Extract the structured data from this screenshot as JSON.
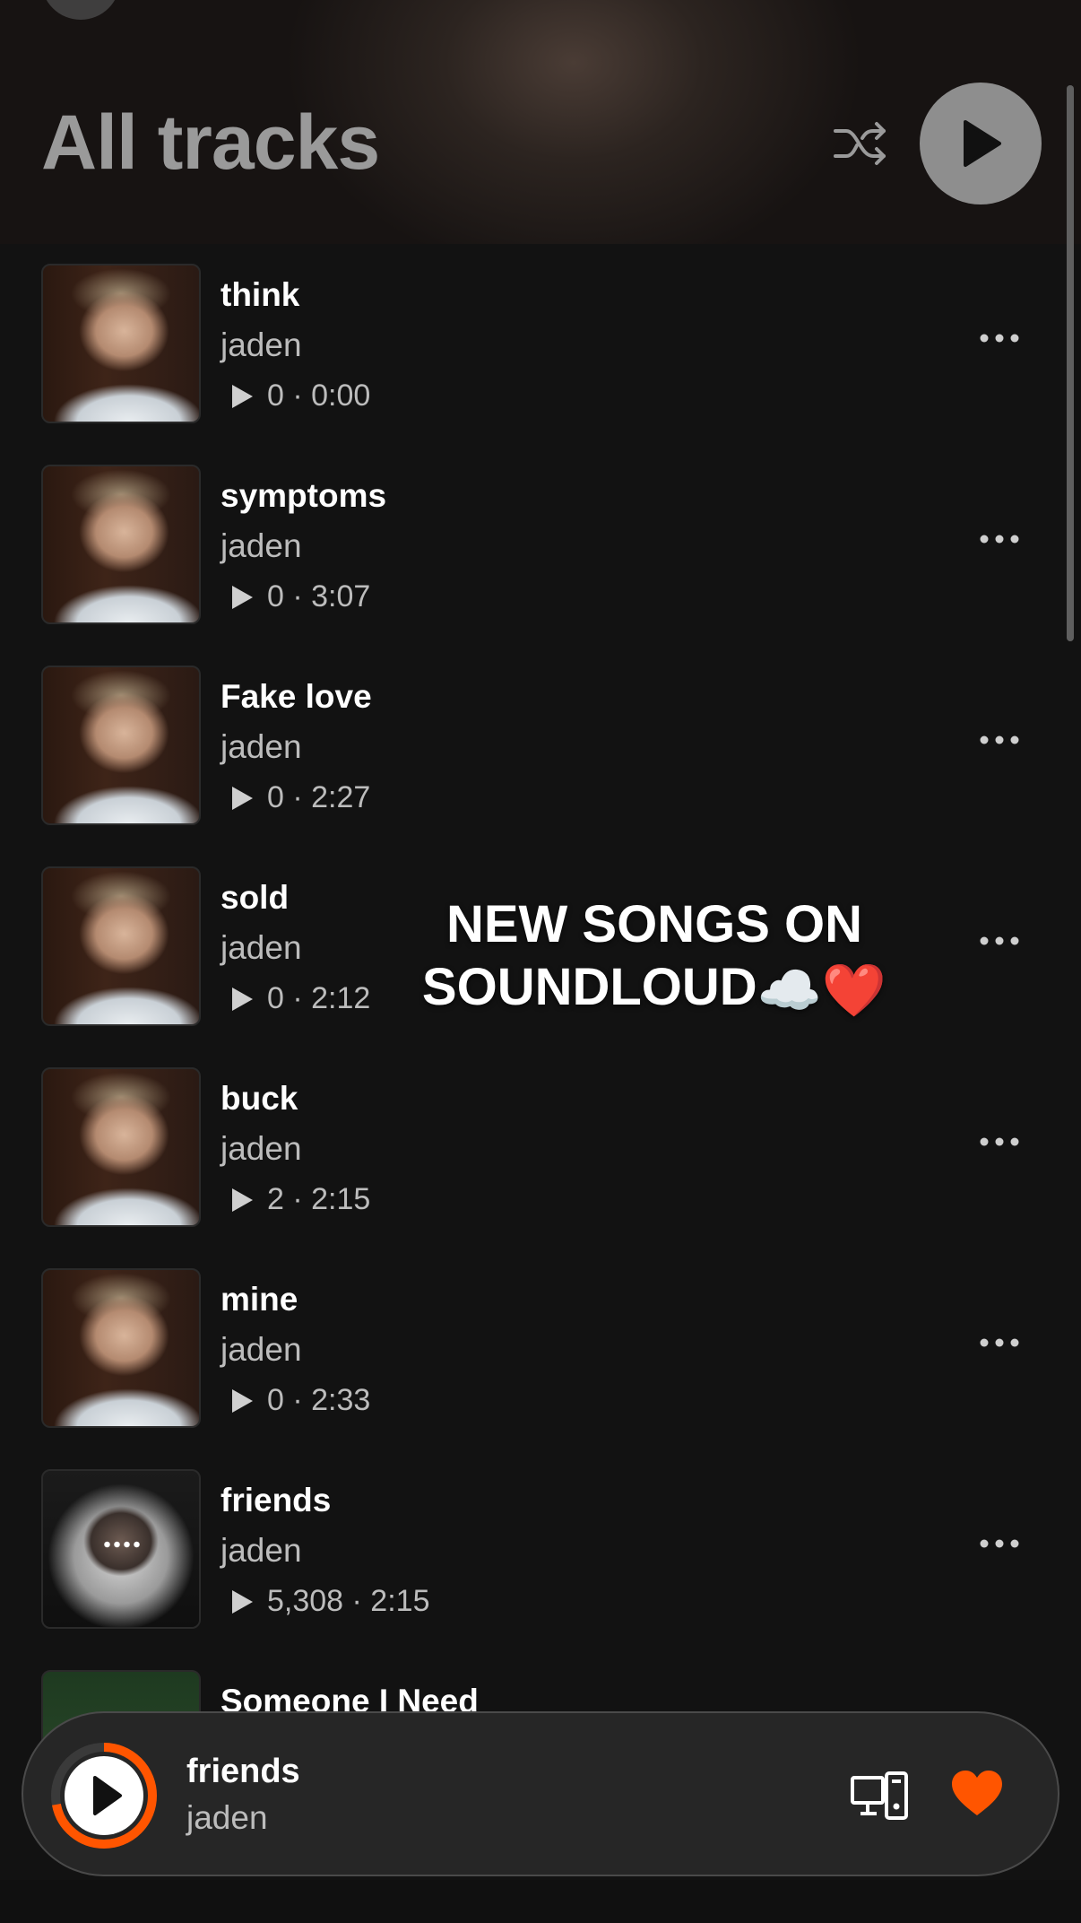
{
  "header": {
    "title": "All tracks",
    "shuffle_icon": "shuffle-icon",
    "play_icon": "play-icon"
  },
  "tracks": [
    {
      "title": "think",
      "artist": "jaden",
      "plays": "0",
      "duration": "0:00",
      "artwork": "toddler-photo"
    },
    {
      "title": "symptoms",
      "artist": "jaden",
      "plays": "0",
      "duration": "3:07",
      "artwork": "toddler-photo"
    },
    {
      "title": "Fake love",
      "artist": "jaden",
      "plays": "0",
      "duration": "2:27",
      "artwork": "toddler-photo"
    },
    {
      "title": "sold",
      "artist": "jaden",
      "plays": "0",
      "duration": "2:12",
      "artwork": "toddler-photo"
    },
    {
      "title": "buck",
      "artist": "jaden",
      "plays": "2",
      "duration": "2:15",
      "artwork": "toddler-photo"
    },
    {
      "title": "mine",
      "artist": "jaden",
      "plays": "0",
      "duration": "2:33",
      "artwork": "toddler-photo"
    },
    {
      "title": "friends",
      "artist": "jaden",
      "plays": "5,308",
      "duration": "2:15",
      "artwork": "hooded-photo"
    },
    {
      "title": "Someone I Need",
      "artist": "",
      "plays": "",
      "duration": "",
      "artwork": "green-photo"
    }
  ],
  "overlay": {
    "line1": "NEW SONGS ON",
    "line2": "SOUNDLOUD",
    "emoji": "☁️❤️"
  },
  "mini_player": {
    "title": "friends",
    "artist": "jaden",
    "progress": 0.72
  },
  "colors": {
    "accent": "#ff5500",
    "background": "#121212",
    "secondary_text": "#bcbcbc"
  }
}
